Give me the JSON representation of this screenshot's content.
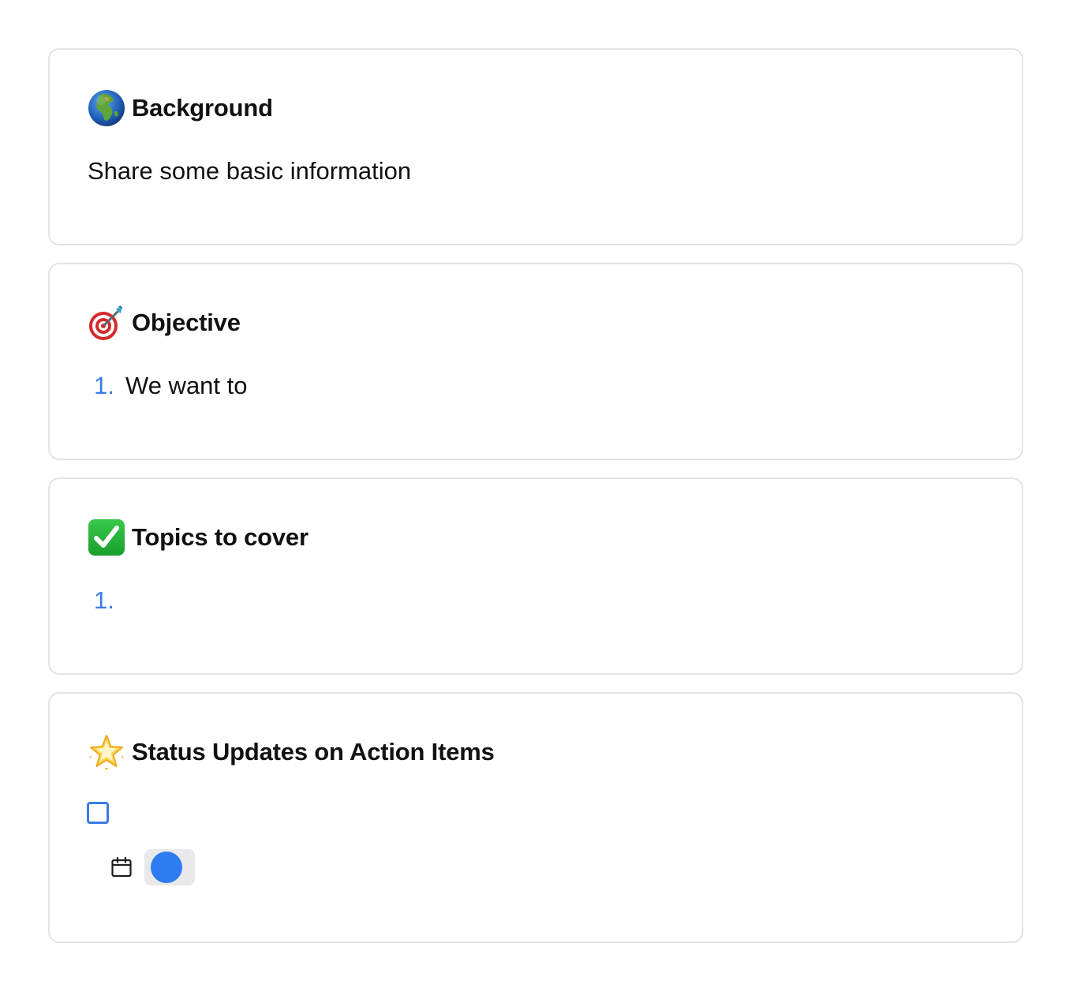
{
  "sections": {
    "background": {
      "icon": "globe-europe-africa-icon",
      "title": "Background",
      "body": "Share some basic information"
    },
    "objective": {
      "icon": "direct-hit-dart-icon",
      "title": "Objective",
      "items": [
        {
          "number": "1.",
          "text": "We want to"
        }
      ]
    },
    "topics": {
      "icon": "check-mark-button-icon",
      "title": "Topics to cover",
      "items": [
        {
          "number": "1.",
          "text": ""
        }
      ]
    },
    "status": {
      "icon": "glowing-star-icon",
      "title": "Status Updates on Action Items",
      "task": {
        "checked": false,
        "date_icon": "calendar-icon",
        "assignee_color": "#2f7bf0"
      }
    }
  },
  "colors": {
    "accent": "#3a7be8",
    "card_border": "#e3e3e3",
    "chip_bg": "#e9e9eb"
  }
}
